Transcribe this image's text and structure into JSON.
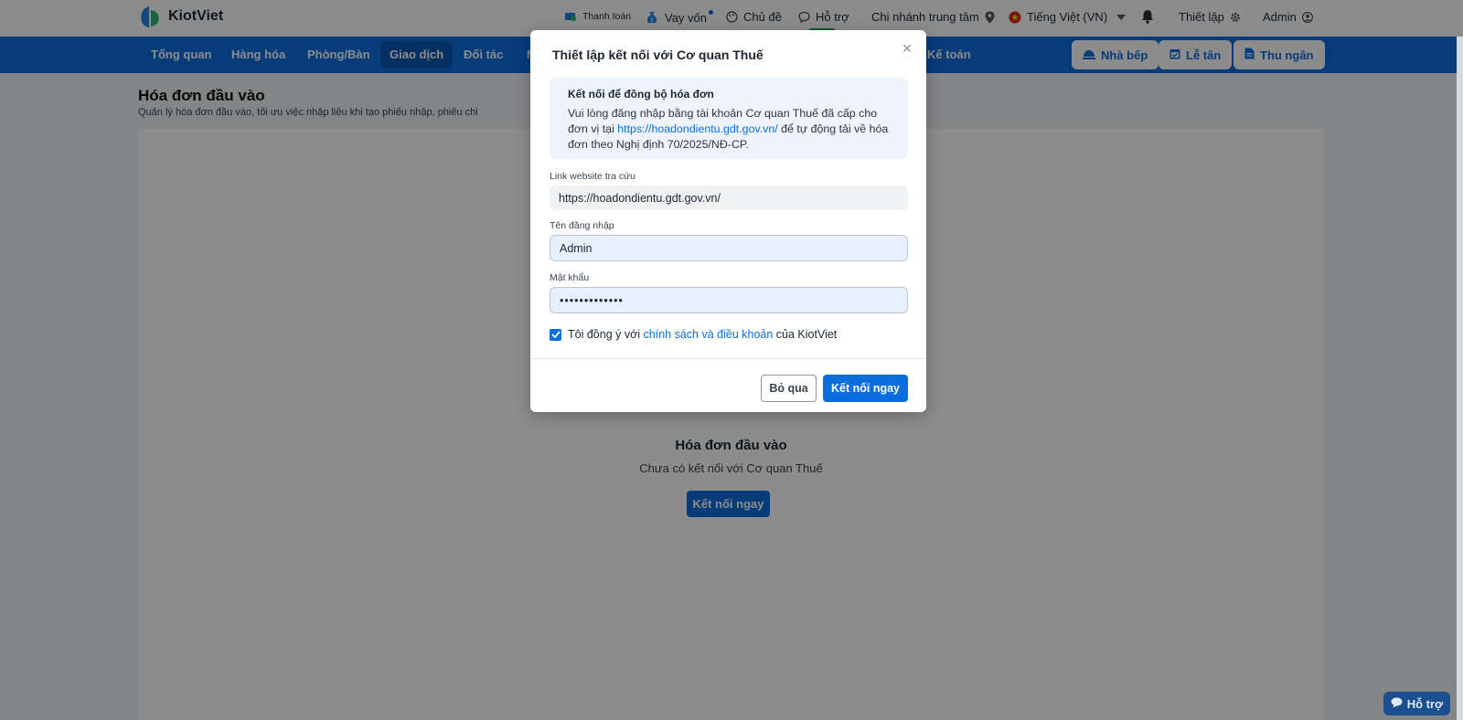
{
  "brand": {
    "name": "KiotViet"
  },
  "topbar": {
    "payment": "Thanh toán",
    "loan": "Vay vốn",
    "theme": "Chủ đề",
    "support": "Hỗ trợ",
    "branch": "Chi nhánh trung tâm",
    "language": "Tiếng Việt (VN)",
    "settings": "Thiết lập",
    "user": "Admin"
  },
  "nav": {
    "items": [
      "Tổng quan",
      "Hàng hóa",
      "Phòng/Bàn",
      "Giao dịch",
      "Đối tác",
      "N",
      "Kế toán"
    ],
    "active": "Giao dịch",
    "buttons": {
      "kitchen": "Nhà bếp",
      "reception": "Lễ tân",
      "cashier": "Thu ngân"
    }
  },
  "page": {
    "title": "Hóa đơn đầu vào",
    "subtitle": "Quản lý hóa đơn đầu vào, tối ưu việc nhập liệu khi tạo phiếu nhập, phiếu chi",
    "empty": {
      "title": "Hóa đơn đầu vào",
      "subtitle": "Chưa có kết nối với Cơ quan Thuế",
      "button": "Kết nối ngay"
    }
  },
  "modal": {
    "title": "Thiết lập kết nối với Cơ quan Thuế",
    "info": {
      "title": "Kết nối để đồng bộ hóa đơn",
      "text_before": "Vui lòng đăng nhập bằng tài khoản Cơ quan Thuế đã cấp cho đơn vị tại ",
      "link": "https://hoadondientu.gdt.gov.vn/",
      "text_after": " để tự động tải về hóa đơn theo Nghị định 70/2025/NĐ-CP."
    },
    "fields": {
      "website_label": "Link website tra cứu",
      "website_value": "https://hoadondientu.gdt.gov.vn/",
      "username_label": "Tên đăng nhập",
      "username_value": "Admin",
      "password_label": "Mật khẩu",
      "password_value": "•••••••••••••"
    },
    "agree": {
      "checked": true,
      "before": "Tôi đồng ý với ",
      "link": "chính sách và điều khoản",
      "after": " của KiotViet"
    },
    "cancel": "Bỏ qua",
    "connect": "Kết nối ngay"
  },
  "support_widget": {
    "label": "Hỗ trợ"
  },
  "colors": {
    "primary": "#0b6ede",
    "nav_active": "#0a58b5",
    "overlay": "rgba(0,0,0,0.45)"
  }
}
